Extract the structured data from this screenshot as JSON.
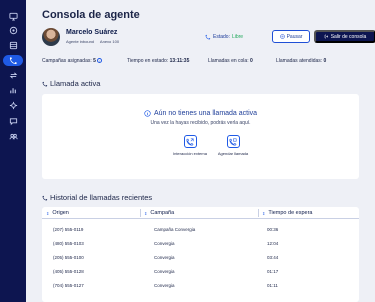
{
  "sidebar": {
    "items": [
      {
        "icon": "monitor-icon"
      },
      {
        "icon": "home-icon"
      },
      {
        "icon": "calendar-icon"
      },
      {
        "icon": "phone-icon",
        "active": true
      },
      {
        "icon": "transfer-icon"
      },
      {
        "icon": "stats-icon"
      },
      {
        "icon": "settings-icon"
      },
      {
        "icon": "chat-icon"
      },
      {
        "icon": "users-icon"
      }
    ]
  },
  "page": {
    "title": "Consola de agente"
  },
  "agent": {
    "name": "Marcelo Suárez",
    "role": "Agente inbound",
    "annex": "Anexo 100"
  },
  "status": {
    "label": "Estado:",
    "value": "Libre"
  },
  "buttons": {
    "pause": "Pausar",
    "exit": "Salir de consola"
  },
  "stats": {
    "campaigns_label": "Campañas asignadas:",
    "campaigns_value": "5",
    "time_label": "Tiempo en estado:",
    "time_value": "13:11:35",
    "queue_label": "Llamadas en cola:",
    "queue_value": "0",
    "answered_label": "Llamadas atendidas:",
    "answered_value": "0"
  },
  "active_call": {
    "heading": "Llamada activa",
    "empty_title": "Aún no tienes una llamada activa",
    "empty_subtitle": "Una vez la hayas recibido, podrás verla aquí.",
    "action_external": "Interacción externa",
    "action_schedule": "Agendar llamada"
  },
  "history": {
    "heading": "Historial de llamadas recientes",
    "columns": [
      "Origen",
      "Campaña",
      "Tiempo de espera"
    ],
    "rows": [
      [
        "(207) 555-0119",
        "Campaña Convergia",
        "00:36"
      ],
      [
        "(480) 555-0103",
        "Convergia",
        "12:04"
      ],
      [
        "(205) 555-0100",
        "Convergia",
        "03:44"
      ],
      [
        "(405) 555-0128",
        "Convergia",
        "01:17"
      ],
      [
        "(704) 555-0127",
        "Convergia",
        "01:11"
      ]
    ]
  },
  "colors": {
    "sidebar": "#0d1550",
    "accent": "#1f5ae6",
    "status_ok": "#1fa85a",
    "background": "#eef0f6"
  }
}
